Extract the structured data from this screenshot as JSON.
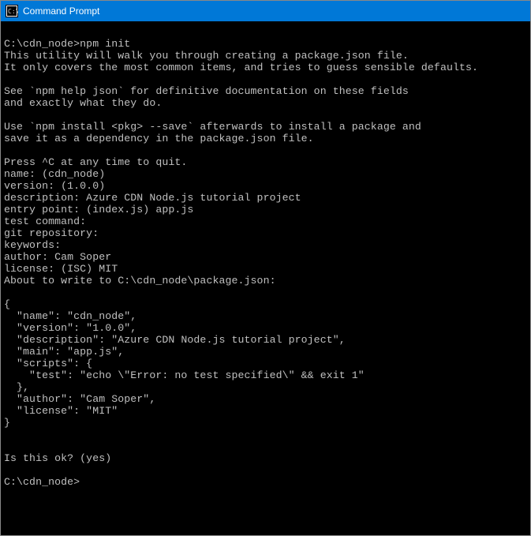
{
  "titlebar": {
    "title": "Command Prompt"
  },
  "terminal": {
    "content": "\nC:\\cdn_node>npm init\nThis utility will walk you through creating a package.json file.\nIt only covers the most common items, and tries to guess sensible defaults.\n\nSee `npm help json` for definitive documentation on these fields\nand exactly what they do.\n\nUse `npm install <pkg> --save` afterwards to install a package and\nsave it as a dependency in the package.json file.\n\nPress ^C at any time to quit.\nname: (cdn_node)\nversion: (1.0.0)\ndescription: Azure CDN Node.js tutorial project\nentry point: (index.js) app.js\ntest command:\ngit repository:\nkeywords:\nauthor: Cam Soper\nlicense: (ISC) MIT\nAbout to write to C:\\cdn_node\\package.json:\n\n{\n  \"name\": \"cdn_node\",\n  \"version\": \"1.0.0\",\n  \"description\": \"Azure CDN Node.js tutorial project\",\n  \"main\": \"app.js\",\n  \"scripts\": {\n    \"test\": \"echo \\\"Error: no test specified\\\" && exit 1\"\n  },\n  \"author\": \"Cam Soper\",\n  \"license\": \"MIT\"\n}\n\n\nIs this ok? (yes)\n\nC:\\cdn_node>"
  }
}
